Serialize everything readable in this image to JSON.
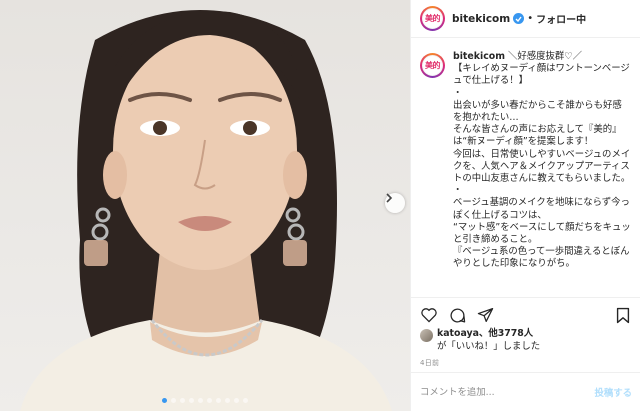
{
  "post": {
    "username": "bitekicom",
    "avatar_text": "美的",
    "follow_status": "フォロー中",
    "separator": "•",
    "caption": "＼好感度抜群♡／\n【キレイめヌーディ顔はワントーンベージュで仕上げる！】\n・\n出会いが多い春だからこそ誰からも好感を抱かれたい…\nそんな皆さんの声にお応えして『美的』は“新ヌーディ顔”を提案します！\n今回は、日常使いしやすいベージュのメイクを、人気ヘア＆メイクアップアーティストの中山友恵さんに教えてもらいました。\n・\nベージュ基調のメイクを地味にならず今っぽく仕上げるコツは、\n“マット感”をベースにして顔だちをキュッと引き締めること。\n『ベージュ系の色って一歩間違えるとぼんやりとした印象になりがち。",
    "likes": {
      "liker": "katoaya",
      "others": "、他3778人",
      "suffix": "が「いいね！」しました"
    },
    "time_ago": "4日前",
    "comment": {
      "placeholder": "コメントを追加...",
      "post_label": "投稿する"
    },
    "carousel": {
      "count": 10,
      "active_index": 0
    }
  },
  "icons": {
    "verified": "verified-badge-icon",
    "like": "heart-icon",
    "comment": "comment-icon",
    "share": "share-icon",
    "save": "bookmark-icon",
    "next": "chevron-right-icon"
  },
  "colors": {
    "accent": "#3897f0",
    "text": "#262626",
    "muted": "#8e8e8e",
    "post_disabled": "#b2dffc",
    "brand": "#e1306c"
  }
}
